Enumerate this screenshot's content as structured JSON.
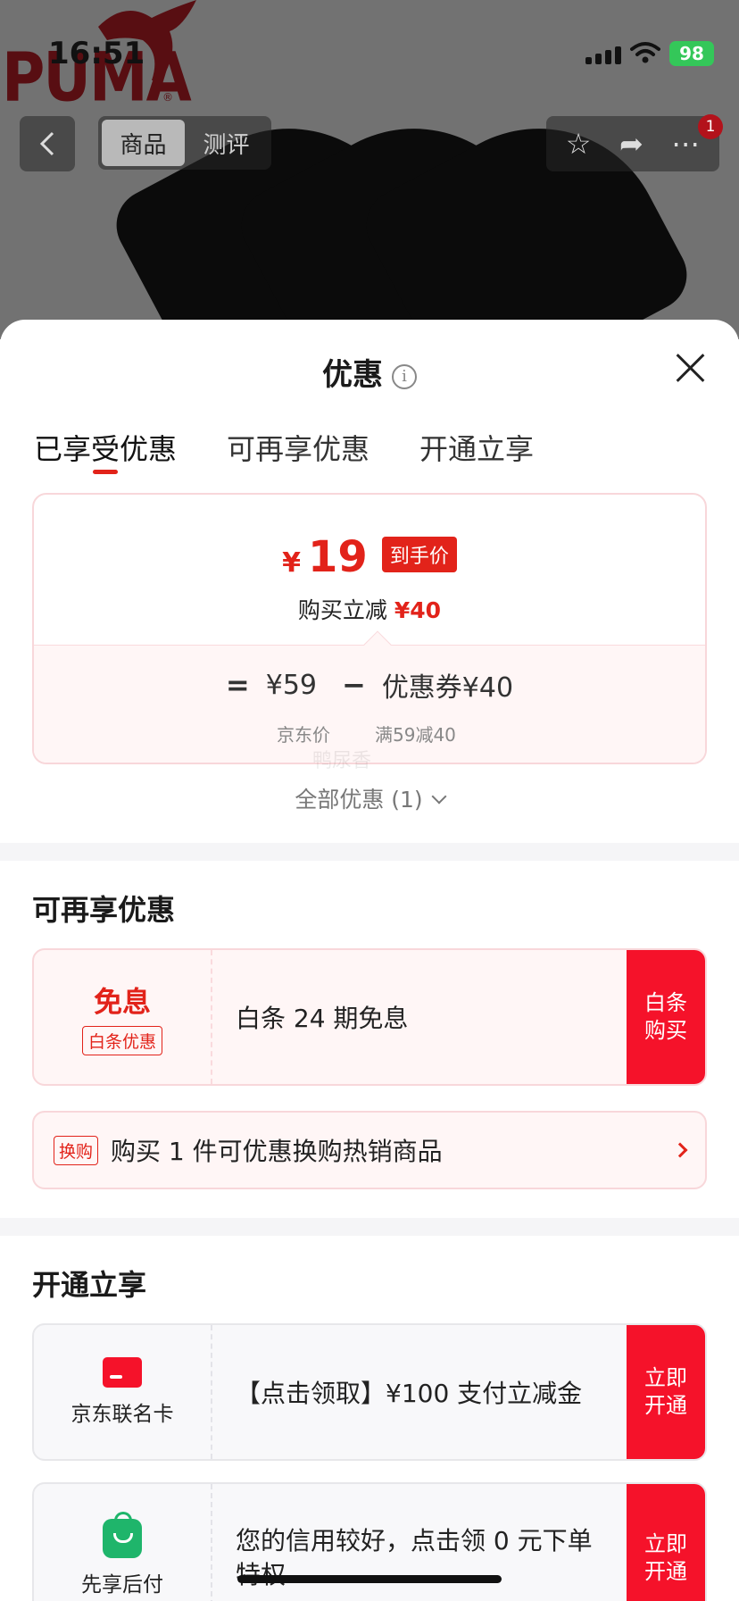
{
  "status_bar": {
    "time": "16:51",
    "battery": "98"
  },
  "background_page": {
    "brand": "PUMA",
    "tabs": [
      "商品",
      "测评"
    ],
    "message_badge": "1"
  },
  "sheet": {
    "title": "优惠",
    "tabs": [
      "已享受优惠",
      "可再享优惠",
      "开通立享"
    ],
    "price_card": {
      "currency": "¥",
      "final_price": "19",
      "final_tag": "到手价",
      "reduction_label": "购买立减",
      "reduction_value": "¥40",
      "equals": "=",
      "list_price": "¥59",
      "list_price_label": "京东价",
      "minus": "−",
      "coupon": "优惠券¥40",
      "coupon_rule": "满59减40"
    },
    "watermark": "鸭尿香",
    "all_promos": "全部优惠 (1)",
    "section_more": {
      "title": "可再享优惠",
      "baitiao": {
        "heading": "免息",
        "chip": "白条优惠",
        "text": "白条 24 期免息",
        "action": "白条购买"
      },
      "redeem": {
        "chip": "换购",
        "text": "购买 1 件可优惠换购热销商品"
      }
    },
    "section_open": {
      "title": "开通立享",
      "items": [
        {
          "label": "京东联名卡",
          "text": "【点击领取】¥100 支付立减金",
          "action": "立即开通",
          "icon": "credit-card-icon"
        },
        {
          "label": "先享后付",
          "text": "您的信用较好，点击领 0 元下单特权",
          "action": "立即开通",
          "icon": "shopping-bag-icon"
        }
      ]
    }
  },
  "colors": {
    "accent": "#e2231a",
    "action": "#f5122a",
    "green": "#1fb56b"
  }
}
